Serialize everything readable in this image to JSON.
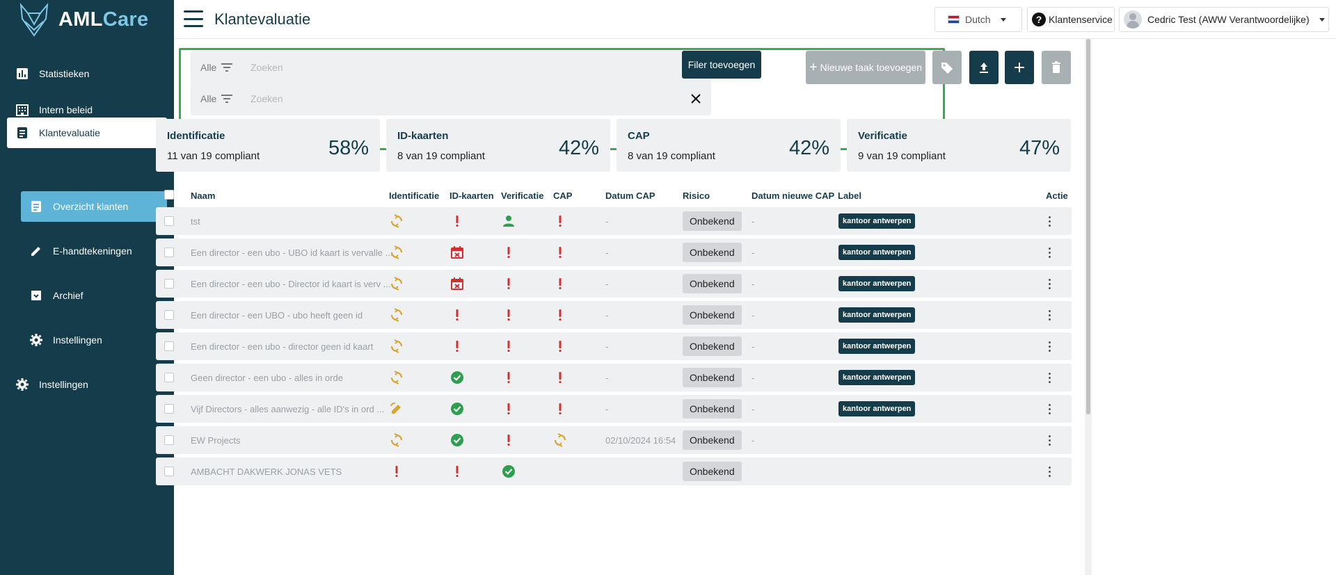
{
  "app": {
    "logo_aml": "AML",
    "logo_care": "Care"
  },
  "sidebar": {
    "items": [
      {
        "label": "Statistieken",
        "icon": "bar-chart-icon"
      },
      {
        "label": "Intern beleid",
        "icon": "building-icon"
      },
      {
        "label": "Klantevaluatie",
        "icon": "document-list-icon",
        "active": true
      },
      {
        "label": "Overzicht klanten",
        "icon": "document-icon",
        "active": true,
        "sub": true
      },
      {
        "label": "E-handtekeningen",
        "icon": "pen-icon",
        "sub": true
      },
      {
        "label": "Archief",
        "icon": "archive-icon",
        "sub": true
      },
      {
        "label": "Instellingen",
        "icon": "gear-icon",
        "sub": true
      },
      {
        "label": "Instellingen",
        "icon": "gear-icon"
      }
    ]
  },
  "header": {
    "title": "Klantevaluatie",
    "language": "Dutch",
    "support": "Klantenservice",
    "user": "Cedric Test (AWW Verantwoordelijke)"
  },
  "filters": {
    "rows": [
      {
        "scope": "Alle",
        "placeholder": "Zoeken",
        "icon": "search-icon"
      },
      {
        "scope": "Alle",
        "placeholder": "Zoeken",
        "icon": "close-icon"
      }
    ],
    "add_label": "Filer toevoegen"
  },
  "actions": {
    "new_task": "Nieuwe taak toevoegen"
  },
  "stats": [
    {
      "title": "Identificatie",
      "sub": "11 van 19 compliant",
      "pct": "58%"
    },
    {
      "title": "ID-kaarten",
      "sub": "8 van 19 compliant",
      "pct": "42%"
    },
    {
      "title": "CAP",
      "sub": "8 van 19 compliant",
      "pct": "42%"
    },
    {
      "title": "Verificatie",
      "sub": "9 van 19 compliant",
      "pct": "47%"
    }
  ],
  "table": {
    "headers": {
      "naam": "Naam",
      "identificatie": "Identificatie",
      "idkaarten": "ID-kaarten",
      "verificatie": "Verificatie",
      "cap": "CAP",
      "datum_cap": "Datum CAP",
      "risico": "Risico",
      "datum_nieuwe_cap": "Datum nieuwe CAP",
      "label": "Label",
      "actie": "Actie"
    },
    "rows": [
      {
        "naam": "tst",
        "id": "sync",
        "idk": "excl",
        "ver": "person",
        "cap": "excl",
        "datum_cap": "-",
        "risico": "Onbekend",
        "datum_nieuwe": "-",
        "label": "kantoor antwerpen"
      },
      {
        "naam": "Een director - een ubo - UBO id kaart is vervalle ...",
        "id": "sync",
        "idk": "cal",
        "ver": "excl",
        "cap": "excl",
        "datum_cap": "-",
        "risico": "Onbekend",
        "datum_nieuwe": "-",
        "label": "kantoor antwerpen"
      },
      {
        "naam": "Een director - een ubo - Director id kaart is verv ...",
        "id": "sync",
        "idk": "cal",
        "ver": "excl",
        "cap": "excl",
        "datum_cap": "-",
        "risico": "Onbekend",
        "datum_nieuwe": "-",
        "label": "kantoor antwerpen"
      },
      {
        "naam": "Een director - een UBO - ubo heeft geen id",
        "id": "sync",
        "idk": "excl",
        "ver": "excl",
        "cap": "excl",
        "datum_cap": "-",
        "risico": "Onbekend",
        "datum_nieuwe": "-",
        "label": "kantoor antwerpen"
      },
      {
        "naam": "Een director - een ubo - director geen id kaart",
        "id": "sync",
        "idk": "excl",
        "ver": "excl",
        "cap": "excl",
        "datum_cap": "-",
        "risico": "Onbekend",
        "datum_nieuwe": "-",
        "label": "kantoor antwerpen"
      },
      {
        "naam": "Geen director - een ubo - alles in orde",
        "id": "sync",
        "idk": "check",
        "ver": "excl",
        "cap": "excl",
        "datum_cap": "-",
        "risico": "Onbekend",
        "datum_nieuwe": "-",
        "label": "kantoor antwerpen"
      },
      {
        "naam": "Vijf Directors - alles aanwezig - alle ID's in ord ...",
        "id": "edit",
        "idk": "check",
        "ver": "excl",
        "cap": "excl",
        "datum_cap": "-",
        "risico": "Onbekend",
        "datum_nieuwe": "-",
        "label": "kantoor antwerpen"
      },
      {
        "naam": "EW Projects",
        "id": "sync",
        "idk": "check",
        "ver": "excl",
        "cap": "sync",
        "datum_cap": "02/10/2024 16:54",
        "risico": "Onbekend",
        "datum_nieuwe": "-",
        "label": ""
      },
      {
        "naam": "AMBACHT DAKWERK JONAS VETS",
        "id": "excl",
        "idk": "excl",
        "ver": "check",
        "cap": "",
        "datum_cap": "",
        "risico": "Onbekend",
        "datum_nieuwe": "",
        "label": ""
      }
    ]
  },
  "colors": {
    "primary": "#153c4a",
    "accent": "#5db4d6",
    "highlight": "#2fb04b",
    "warning": "#d9a531",
    "danger": "#d32f2f",
    "success": "#2e9e4f"
  }
}
